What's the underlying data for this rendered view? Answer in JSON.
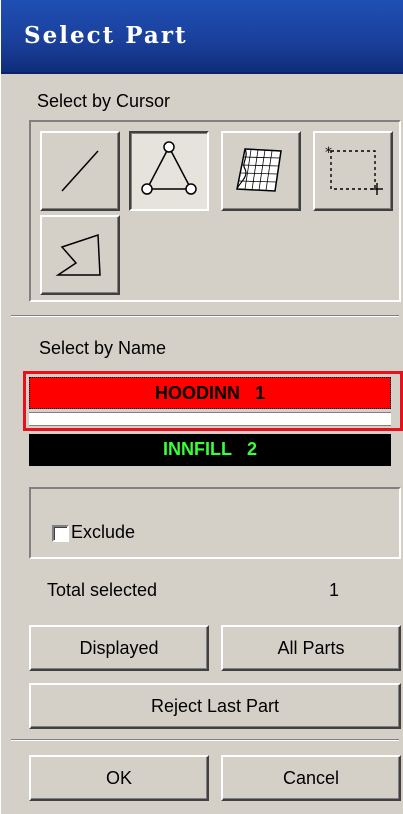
{
  "window": {
    "title": "Select Part"
  },
  "cursor_section": {
    "label": "Select by Cursor",
    "tools": [
      {
        "name": "line-select",
        "icon": "diagonal-line-icon",
        "pressed": false
      },
      {
        "name": "triangle-select",
        "icon": "triangle-nodes-icon",
        "pressed": true
      },
      {
        "name": "surface-select",
        "icon": "mesh-surface-icon",
        "pressed": false
      },
      {
        "name": "box-select",
        "icon": "dashed-box-cursor-icon",
        "pressed": false
      },
      {
        "name": "polygon-select",
        "icon": "polygon-icon",
        "pressed": false
      }
    ]
  },
  "name_section": {
    "label": "Select by Name",
    "parts": [
      {
        "name": "HOODINN",
        "id": "1",
        "selected": true,
        "bg": "#ff0000",
        "fg": "#000000"
      },
      {
        "name": "INNFILL",
        "id": "2",
        "selected": false,
        "bg": "#000000",
        "fg": "#38ff38"
      }
    ]
  },
  "exclude": {
    "label": "Exclude",
    "checked": false
  },
  "total": {
    "label": "Total selected",
    "value": "1"
  },
  "buttons": {
    "displayed": "Displayed",
    "all_parts": "All Parts",
    "reject_last": "Reject Last Part",
    "ok": "OK",
    "cancel": "Cancel"
  },
  "colors": {
    "title_bar": "#1a3f9a",
    "highlight_frame": "#e8101a",
    "panel": "#d4d0c8"
  }
}
